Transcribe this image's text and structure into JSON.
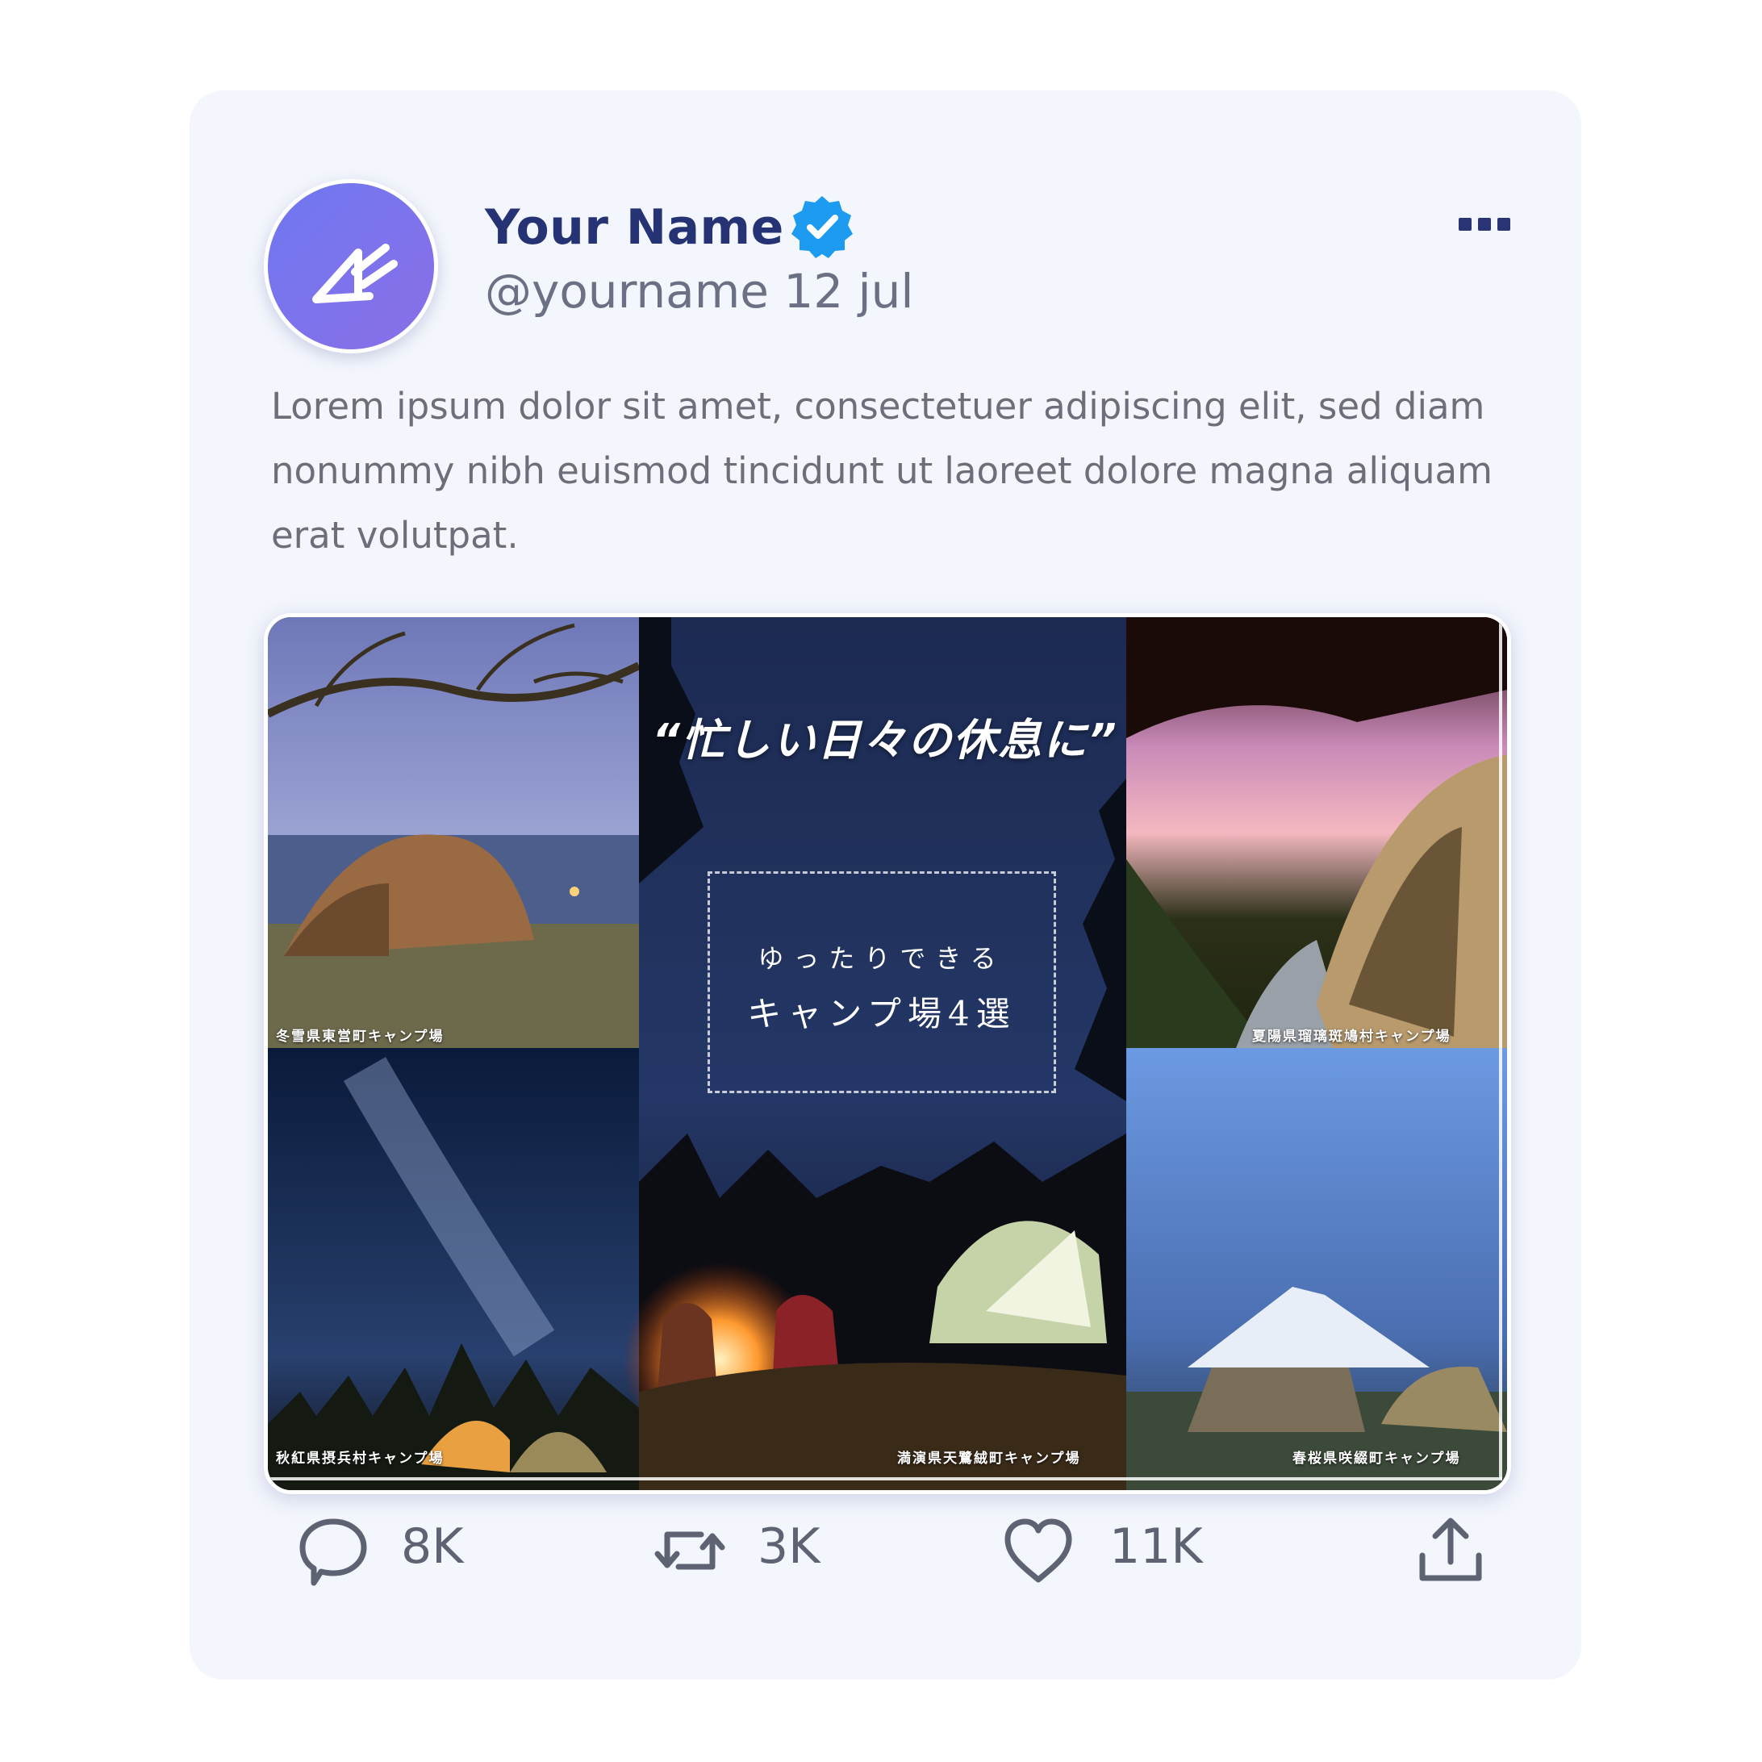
{
  "post": {
    "author_name": "Your Name",
    "handle_date": "@yourname 12 jul",
    "text": "Lorem ipsum dolor sit amet, consectetuer adipiscing elit, sed diam nonummy nibh euismod tincidunt ut laoreet dolore magna aliquam erat volutpat.",
    "verified_icon": "verified-badge-icon",
    "more_icon": "more-options-icon"
  },
  "media": {
    "headline": "“忙しい日々の休息に”",
    "sub_line1": "ゆったりできる",
    "sub_line2": "キャンプ場4選",
    "captions": {
      "top_left": "冬雪県東営町キャンプ場",
      "top_right": "夏陽県瑠璃斑鳩村キャンプ場",
      "bottom_left": "秋紅県摂兵村キャンプ場",
      "center": "満演県天鷺絨町キャンプ場",
      "bottom_right": "春桜県咲綴町キャンプ場"
    }
  },
  "actions": {
    "replies": "8K",
    "retweets": "3K",
    "likes": "11K"
  },
  "colors": {
    "card_bg": "#f3f6fc",
    "name": "#253273",
    "verified": "#1d9bf0",
    "avatar": "#7a74ee",
    "icon": "#5e6373"
  }
}
